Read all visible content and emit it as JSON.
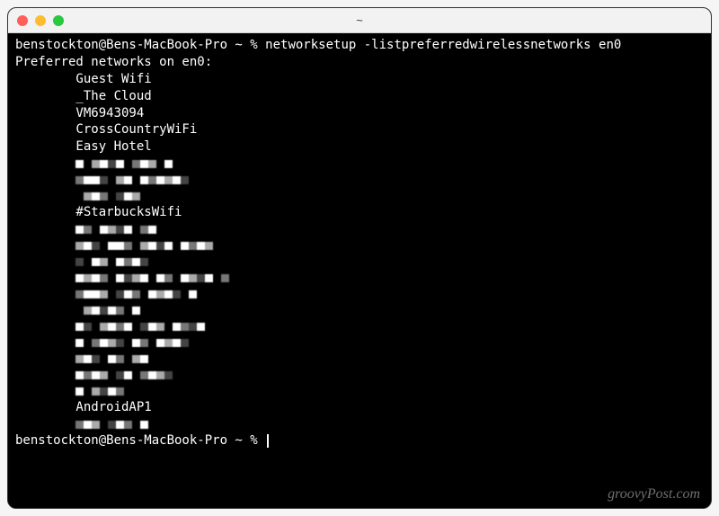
{
  "titlebar": {
    "title": "~"
  },
  "terminal": {
    "prompt": "benstockton@Bens-MacBook-Pro ~ %",
    "command": "networksetup -listpreferredwirelessnetworks en0",
    "header": "Preferred networks on en0:",
    "networks_visible": [
      "Guest Wifi ",
      "_The Cloud",
      "VM6943094",
      "CrossCountryWiFi",
      "Easy Hotel"
    ],
    "network_mid": "#StarbucksWifi",
    "network_last": "AndroidAP1"
  },
  "watermark": "groovyPost.com"
}
